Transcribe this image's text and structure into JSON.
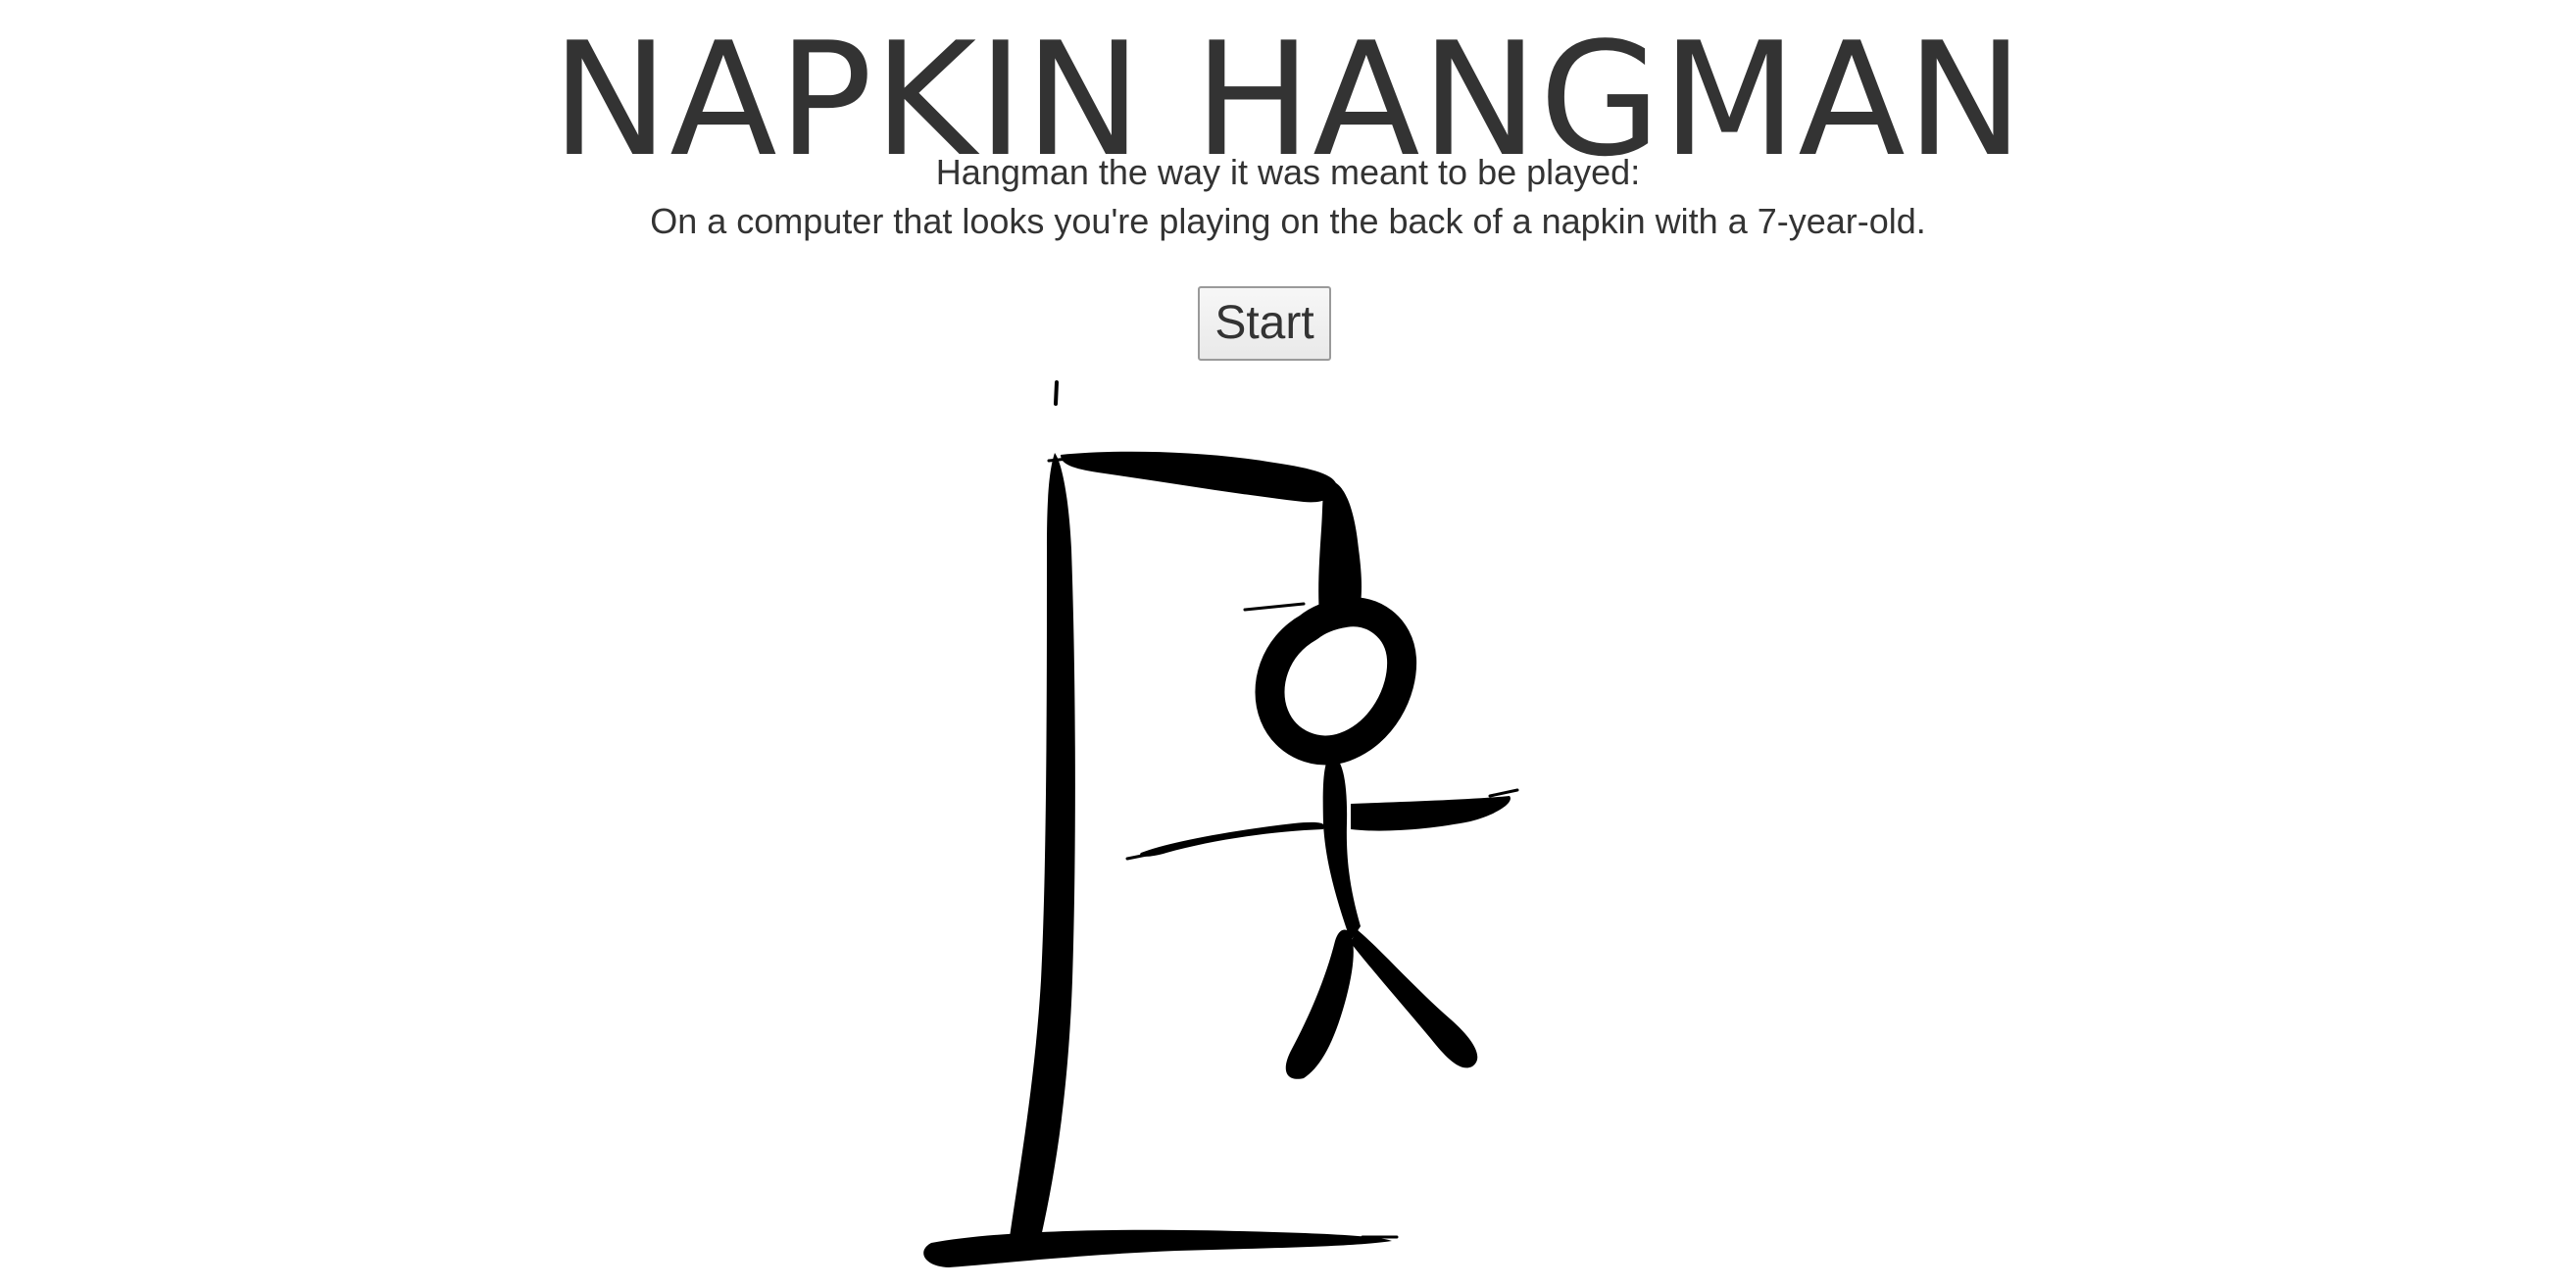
{
  "header": {
    "title": "NAPKIN HANGMAN",
    "subtitle_line1": "Hangman the way it was meant to be played:",
    "subtitle_line2": "On a computer that looks you're playing on the back of a napkin with a 7-year-old."
  },
  "controls": {
    "start_label": "Start"
  },
  "drawing": {
    "ink_color": "#000000",
    "parts_shown": [
      "base",
      "pole",
      "beam",
      "rope",
      "head",
      "body",
      "left-arm",
      "right-arm",
      "left-leg",
      "right-leg"
    ]
  }
}
